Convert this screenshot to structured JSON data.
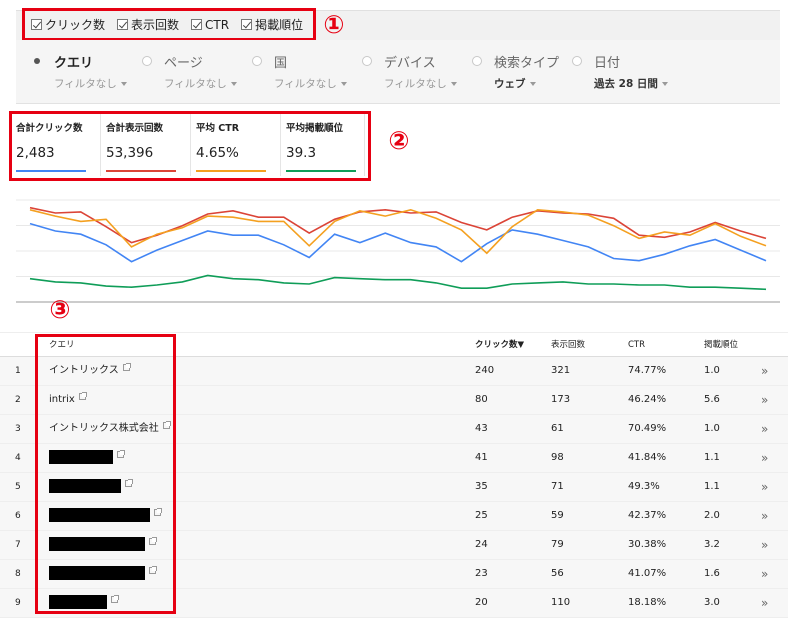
{
  "metric_toggles": [
    {
      "label": "クリック数",
      "checked": true
    },
    {
      "label": "表示回数",
      "checked": true
    },
    {
      "label": "CTR",
      "checked": true
    },
    {
      "label": "掲載順位",
      "checked": true
    }
  ],
  "annotations": {
    "one": "①",
    "two": "②",
    "three": "③"
  },
  "dimensions": [
    {
      "label": "クエリ",
      "sub": "フィルタなし",
      "selected": true
    },
    {
      "label": "ページ",
      "sub": "フィルタなし"
    },
    {
      "label": "国",
      "sub": "フィルタなし"
    },
    {
      "label": "デバイス",
      "sub": "フィルタなし"
    },
    {
      "label": "検索タイプ",
      "sub": "ウェブ"
    },
    {
      "label": "日付",
      "sub": "過去 28 日間"
    }
  ],
  "totals": [
    {
      "label": "合計クリック数",
      "value": "2,483",
      "color": "#4285f4"
    },
    {
      "label": "合計表示回数",
      "value": "53,396",
      "color": "#db4437"
    },
    {
      "label": "平均 CTR",
      "value": "4.65%",
      "color": "#f4a020"
    },
    {
      "label": "平均掲載順位",
      "value": "39.3",
      "color": "#0f9d58"
    }
  ],
  "chart_data": {
    "type": "line",
    "grid": true,
    "legend": "none",
    "x": [
      1,
      2,
      3,
      4,
      5,
      6,
      7,
      8,
      9,
      10,
      11,
      12,
      13,
      14,
      15,
      16,
      17,
      18,
      19,
      20,
      21,
      22,
      23,
      24,
      25,
      26,
      27,
      28,
      29,
      30
    ],
    "ylim": [
      0,
      100
    ],
    "series": [
      {
        "color": "#4285f4",
        "values": [
          74,
          67,
          64,
          54,
          38,
          49,
          58,
          67,
          63,
          63,
          54,
          42,
          64,
          56,
          65,
          56,
          52,
          38,
          55,
          68,
          64,
          58,
          52,
          41,
          39,
          45,
          53,
          59,
          49,
          39
        ]
      },
      {
        "color": "#db4437",
        "values": [
          89,
          84,
          85,
          71,
          56,
          63,
          72,
          83,
          86,
          80,
          80,
          65,
          78,
          85,
          87,
          84,
          85,
          75,
          68,
          80,
          86,
          84,
          83,
          79,
          63,
          61,
          66,
          75,
          67,
          60
        ]
      },
      {
        "color": "#f4a020",
        "values": [
          87,
          81,
          76,
          78,
          52,
          64,
          70,
          81,
          80,
          76,
          76,
          53,
          76,
          86,
          81,
          87,
          79,
          68,
          46,
          71,
          87,
          85,
          82,
          72,
          60,
          66,
          63,
          74,
          62,
          53
        ]
      },
      {
        "color": "#0f9d58",
        "values": [
          22,
          19,
          18,
          15,
          14,
          16,
          19,
          25,
          22,
          21,
          18,
          17,
          23,
          22,
          21,
          21,
          18,
          13,
          13,
          17,
          18,
          19,
          17,
          17,
          16,
          16,
          14,
          14,
          13,
          12
        ]
      }
    ]
  },
  "table": {
    "headers": {
      "query": "クエリ",
      "clicks": "クリック数▼",
      "impressions": "表示回数",
      "ctr": "CTR",
      "position": "掲載順位"
    },
    "rows": [
      {
        "num": "1",
        "query": "イントリックス",
        "clicks": "240",
        "impressions": "321",
        "ctr": "74.77%",
        "position": "1.0"
      },
      {
        "num": "2",
        "query": "intrix",
        "clicks": "80",
        "impressions": "173",
        "ctr": "46.24%",
        "position": "5.6"
      },
      {
        "num": "3",
        "query": "イントリックス株式会社",
        "clicks": "43",
        "impressions": "61",
        "ctr": "70.49%",
        "position": "1.0"
      },
      {
        "num": "4",
        "query": "",
        "clicks": "41",
        "impressions": "98",
        "ctr": "41.84%",
        "position": "1.1"
      },
      {
        "num": "5",
        "query": "",
        "clicks": "35",
        "impressions": "71",
        "ctr": "49.3%",
        "position": "1.1"
      },
      {
        "num": "6",
        "query": "",
        "clicks": "25",
        "impressions": "59",
        "ctr": "42.37%",
        "position": "2.0"
      },
      {
        "num": "7",
        "query": "",
        "clicks": "24",
        "impressions": "79",
        "ctr": "30.38%",
        "position": "3.2"
      },
      {
        "num": "8",
        "query": "",
        "clicks": "23",
        "impressions": "56",
        "ctr": "41.07%",
        "position": "1.6"
      },
      {
        "num": "9",
        "query": "",
        "clicks": "20",
        "impressions": "110",
        "ctr": "18.18%",
        "position": "3.0"
      }
    ],
    "go_label": "»"
  },
  "colors": {
    "highlight": "#e60012"
  }
}
